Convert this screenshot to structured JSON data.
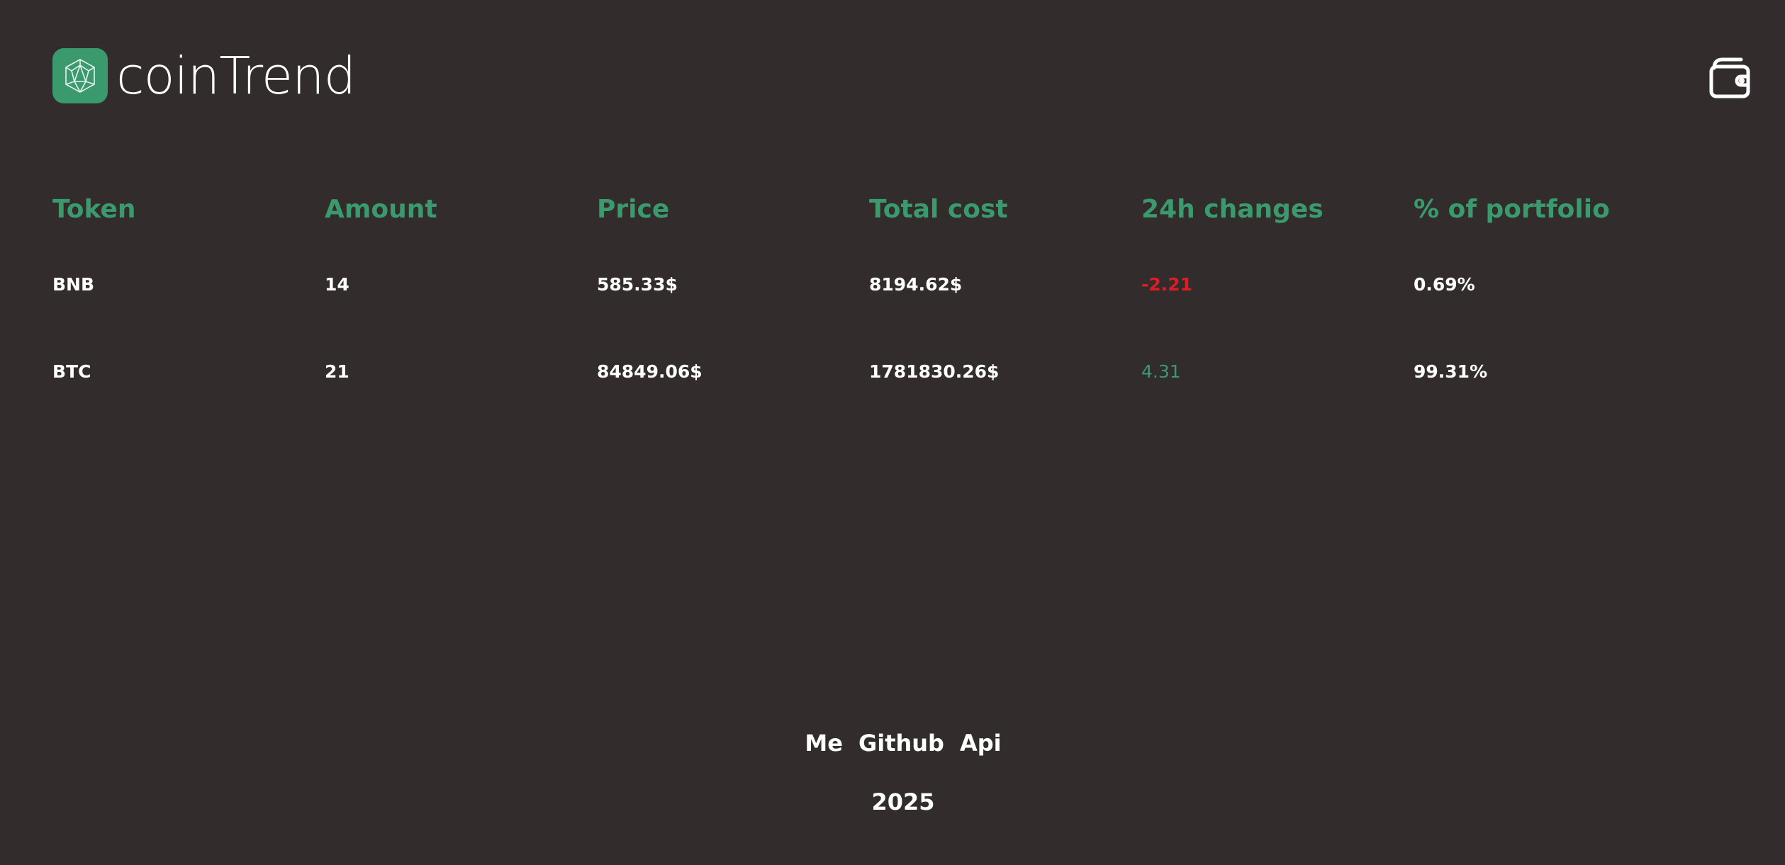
{
  "header": {
    "app_title": "coinTrend",
    "logo_icon": "polyhedron-icon",
    "wallet_icon": "wallet-icon"
  },
  "table": {
    "columns": [
      "Token",
      "Amount",
      "Price",
      "Total cost",
      "24h changes",
      "% of portfolio"
    ],
    "rows": [
      {
        "token": "BNB",
        "amount": "14",
        "price": "585.33$",
        "total_cost": "8194.62$",
        "change_24h": "-2.21",
        "portfolio_pct": "0.69%"
      },
      {
        "token": "BTC",
        "amount": "21",
        "price": "84849.06$",
        "total_cost": "1781830.26$",
        "change_24h": "4.31",
        "portfolio_pct": "99.31%"
      }
    ]
  },
  "footer": {
    "links": [
      "Me",
      "Github",
      "Api"
    ],
    "year": "2025"
  },
  "colors": {
    "background": "#322c2c",
    "accent": "#3a9a6d",
    "negative": "#e01b24",
    "text": "#ffffff"
  }
}
